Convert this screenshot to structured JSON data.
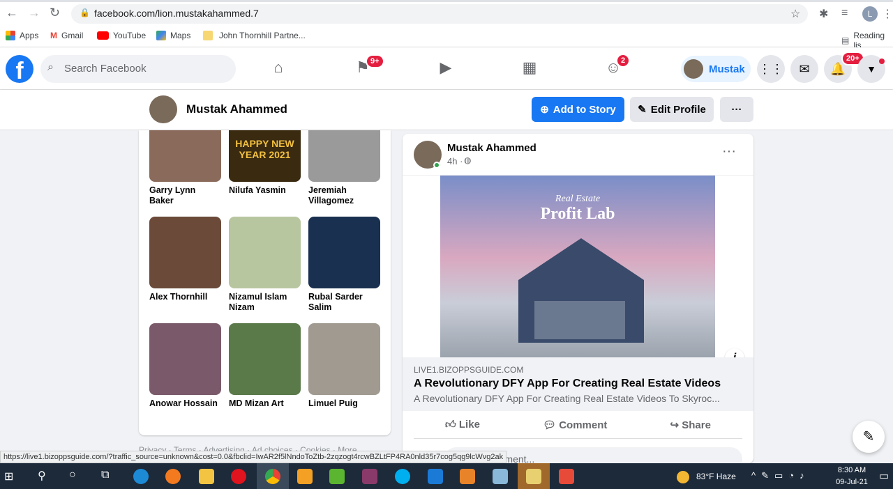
{
  "browser": {
    "url": "facebook.com/lion.mustakahammed.7",
    "bookmarks": [
      "Apps",
      "Gmail",
      "YouTube",
      "Maps",
      "John Thornhill Partne..."
    ],
    "reading_list": "Reading lis",
    "profile_initial": "L"
  },
  "header": {
    "logo": "f",
    "search_placeholder": "Search Facebook",
    "pages_badge": "9+",
    "groups_badge": "2",
    "user_name": "Mustak",
    "notifications_badge": "20+"
  },
  "profile": {
    "name": "Mustak Ahammed",
    "add_story": "Add to Story",
    "edit_profile": "Edit Profile",
    "more": "···"
  },
  "friends": [
    {
      "name": "Garry Lynn Baker",
      "color": "#8a6a5a"
    },
    {
      "name": "Nilufa Yasmin",
      "color": "#3a2a10",
      "text": "HAPPY NEW YEAR 2021"
    },
    {
      "name": "Jeremiah Villagomez",
      "color": "#9a9a9a"
    },
    {
      "name": "Alex Thornhill",
      "color": "#6b4a3a"
    },
    {
      "name": "Nizamul Islam Nizam",
      "color": "#b8c6a0"
    },
    {
      "name": "Rubal Sarder Salim",
      "color": "#1a3050"
    },
    {
      "name": "Anowar Hossain",
      "color": "#7a5a6a"
    },
    {
      "name": "MD Mizan Art",
      "color": "#5a7a4a"
    },
    {
      "name": "Limuel Puig",
      "color": "#a09a90"
    }
  ],
  "footer_links": "Privacy · Terms · Advertising · Ad choices · Cookies · More",
  "post": {
    "author": "Mustak Ahammed",
    "time": "4h ·",
    "image_title_1": "Real Estate",
    "image_title_2": "Profit Lab",
    "domain": "LIVE1.BIZOPPSGUIDE.COM",
    "title": "A Revolutionary DFY App For Creating Real Estate Videos",
    "description": "A Revolutionary DFY App For Creating Real Estate Videos To Skyroc...",
    "like": "Like",
    "comment": "Comment",
    "share": "Share",
    "comment_placeholder": "Write a comment..."
  },
  "status_url": "https://live1.bizoppsguide.com/?traffic_source=unknown&cost=0.0&fbclid=IwAR2f5lNndoToZtb-2zqzogt4rcwBZLtFP4RA0nld35r7cog5qg9lcWvg2ak",
  "taskbar": {
    "weather": "83°F  Haze",
    "time": "8:30 AM",
    "date": "09-Jul-21"
  }
}
